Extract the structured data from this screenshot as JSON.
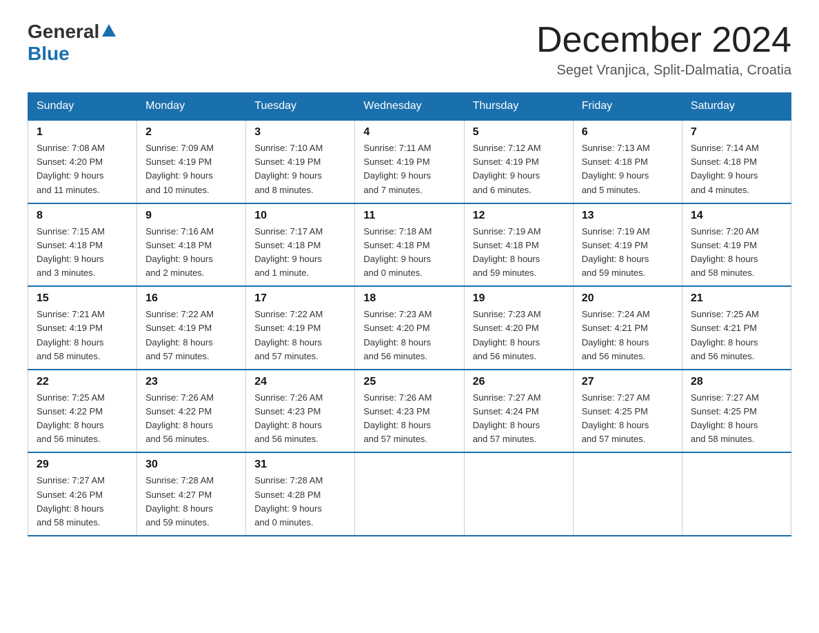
{
  "header": {
    "logo_general": "General",
    "logo_blue": "Blue",
    "month_title": "December 2024",
    "location": "Seget Vranjica, Split-Dalmatia, Croatia"
  },
  "days_of_week": [
    "Sunday",
    "Monday",
    "Tuesday",
    "Wednesday",
    "Thursday",
    "Friday",
    "Saturday"
  ],
  "weeks": [
    [
      {
        "day": "1",
        "sunrise": "7:08 AM",
        "sunset": "4:20 PM",
        "daylight": "9 hours and 11 minutes."
      },
      {
        "day": "2",
        "sunrise": "7:09 AM",
        "sunset": "4:19 PM",
        "daylight": "9 hours and 10 minutes."
      },
      {
        "day": "3",
        "sunrise": "7:10 AM",
        "sunset": "4:19 PM",
        "daylight": "9 hours and 8 minutes."
      },
      {
        "day": "4",
        "sunrise": "7:11 AM",
        "sunset": "4:19 PM",
        "daylight": "9 hours and 7 minutes."
      },
      {
        "day": "5",
        "sunrise": "7:12 AM",
        "sunset": "4:19 PM",
        "daylight": "9 hours and 6 minutes."
      },
      {
        "day": "6",
        "sunrise": "7:13 AM",
        "sunset": "4:18 PM",
        "daylight": "9 hours and 5 minutes."
      },
      {
        "day": "7",
        "sunrise": "7:14 AM",
        "sunset": "4:18 PM",
        "daylight": "9 hours and 4 minutes."
      }
    ],
    [
      {
        "day": "8",
        "sunrise": "7:15 AM",
        "sunset": "4:18 PM",
        "daylight": "9 hours and 3 minutes."
      },
      {
        "day": "9",
        "sunrise": "7:16 AM",
        "sunset": "4:18 PM",
        "daylight": "9 hours and 2 minutes."
      },
      {
        "day": "10",
        "sunrise": "7:17 AM",
        "sunset": "4:18 PM",
        "daylight": "9 hours and 1 minute."
      },
      {
        "day": "11",
        "sunrise": "7:18 AM",
        "sunset": "4:18 PM",
        "daylight": "9 hours and 0 minutes."
      },
      {
        "day": "12",
        "sunrise": "7:19 AM",
        "sunset": "4:18 PM",
        "daylight": "8 hours and 59 minutes."
      },
      {
        "day": "13",
        "sunrise": "7:19 AM",
        "sunset": "4:19 PM",
        "daylight": "8 hours and 59 minutes."
      },
      {
        "day": "14",
        "sunrise": "7:20 AM",
        "sunset": "4:19 PM",
        "daylight": "8 hours and 58 minutes."
      }
    ],
    [
      {
        "day": "15",
        "sunrise": "7:21 AM",
        "sunset": "4:19 PM",
        "daylight": "8 hours and 58 minutes."
      },
      {
        "day": "16",
        "sunrise": "7:22 AM",
        "sunset": "4:19 PM",
        "daylight": "8 hours and 57 minutes."
      },
      {
        "day": "17",
        "sunrise": "7:22 AM",
        "sunset": "4:19 PM",
        "daylight": "8 hours and 57 minutes."
      },
      {
        "day": "18",
        "sunrise": "7:23 AM",
        "sunset": "4:20 PM",
        "daylight": "8 hours and 56 minutes."
      },
      {
        "day": "19",
        "sunrise": "7:23 AM",
        "sunset": "4:20 PM",
        "daylight": "8 hours and 56 minutes."
      },
      {
        "day": "20",
        "sunrise": "7:24 AM",
        "sunset": "4:21 PM",
        "daylight": "8 hours and 56 minutes."
      },
      {
        "day": "21",
        "sunrise": "7:25 AM",
        "sunset": "4:21 PM",
        "daylight": "8 hours and 56 minutes."
      }
    ],
    [
      {
        "day": "22",
        "sunrise": "7:25 AM",
        "sunset": "4:22 PM",
        "daylight": "8 hours and 56 minutes."
      },
      {
        "day": "23",
        "sunrise": "7:26 AM",
        "sunset": "4:22 PM",
        "daylight": "8 hours and 56 minutes."
      },
      {
        "day": "24",
        "sunrise": "7:26 AM",
        "sunset": "4:23 PM",
        "daylight": "8 hours and 56 minutes."
      },
      {
        "day": "25",
        "sunrise": "7:26 AM",
        "sunset": "4:23 PM",
        "daylight": "8 hours and 57 minutes."
      },
      {
        "day": "26",
        "sunrise": "7:27 AM",
        "sunset": "4:24 PM",
        "daylight": "8 hours and 57 minutes."
      },
      {
        "day": "27",
        "sunrise": "7:27 AM",
        "sunset": "4:25 PM",
        "daylight": "8 hours and 57 minutes."
      },
      {
        "day": "28",
        "sunrise": "7:27 AM",
        "sunset": "4:25 PM",
        "daylight": "8 hours and 58 minutes."
      }
    ],
    [
      {
        "day": "29",
        "sunrise": "7:27 AM",
        "sunset": "4:26 PM",
        "daylight": "8 hours and 58 minutes."
      },
      {
        "day": "30",
        "sunrise": "7:28 AM",
        "sunset": "4:27 PM",
        "daylight": "8 hours and 59 minutes."
      },
      {
        "day": "31",
        "sunrise": "7:28 AM",
        "sunset": "4:28 PM",
        "daylight": "9 hours and 0 minutes."
      },
      null,
      null,
      null,
      null
    ]
  ],
  "labels": {
    "sunrise": "Sunrise:",
    "sunset": "Sunset:",
    "daylight": "Daylight:"
  }
}
